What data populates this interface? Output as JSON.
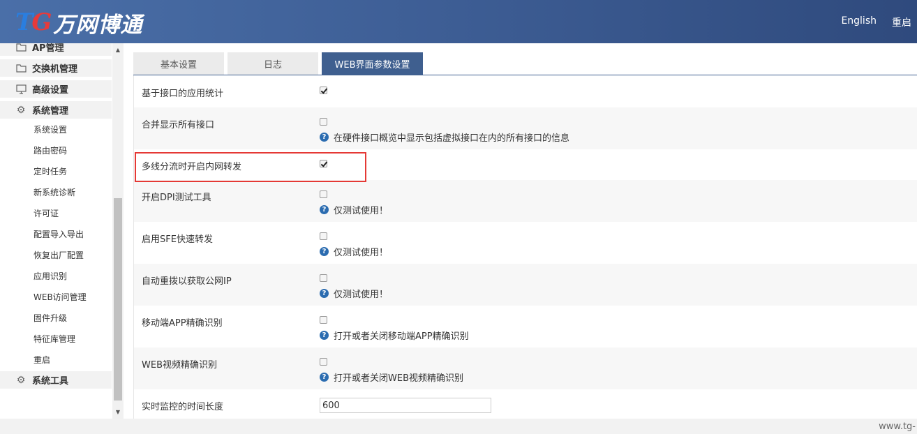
{
  "header": {
    "logo_tg_t": "T",
    "logo_tg_g": "G",
    "logo_cn": "万网博通",
    "links": [
      "English",
      "重启"
    ]
  },
  "sidebar": {
    "main_top": [
      {
        "label": "AP管理",
        "icon": "folder-icon"
      },
      {
        "label": "交换机管理",
        "icon": "folder-icon"
      },
      {
        "label": "高级设置",
        "icon": "monitor-icon"
      },
      {
        "label": "系统管理",
        "icon": "gear-icon"
      }
    ],
    "sub_items": [
      "系统设置",
      "路由密码",
      "定时任务",
      "新系统诊断",
      "许可证",
      "配置导入导出",
      "恢复出厂配置",
      "应用识别",
      "WEB访问管理",
      "固件升级",
      "特征库管理",
      "重启"
    ],
    "main_bottom": {
      "label": "系统工具",
      "icon": "gear-icon"
    }
  },
  "tabs": [
    "基本设置",
    "日志",
    "WEB界面参数设置"
  ],
  "rows": [
    {
      "label": "基于接口的应用统计",
      "checked": true,
      "hint": ""
    },
    {
      "label": "合并显示所有接口",
      "checked": false,
      "hint": "在硬件接口概览中显示包括虚拟接口在内的所有接口的信息"
    },
    {
      "label": "多线分流时开启内网转发",
      "checked": true,
      "hint": ""
    },
    {
      "label": "开启DPI测试工具",
      "checked": false,
      "hint": "仅测试使用！"
    },
    {
      "label": "启用SFE快速转发",
      "checked": false,
      "hint": "仅测试使用！"
    },
    {
      "label": "自动重拨以获取公网IP",
      "checked": false,
      "hint": "仅测试使用！"
    },
    {
      "label": "移动端APP精确识别",
      "checked": false,
      "hint": "打开或者关闭移动端APP精确识别"
    },
    {
      "label": "WEB视频精确识别",
      "checked": false,
      "hint": "打开或者关闭WEB视频精确识别"
    }
  ],
  "monitor_row": {
    "label": "实时监控的时间长度",
    "value": "600"
  },
  "footer": {
    "text": "www.tg-"
  },
  "colors": {
    "header": "#3d5d94",
    "active_tab": "#3f5f8f",
    "highlight": "#e53935",
    "hint_icon": "#2b6cb0"
  }
}
